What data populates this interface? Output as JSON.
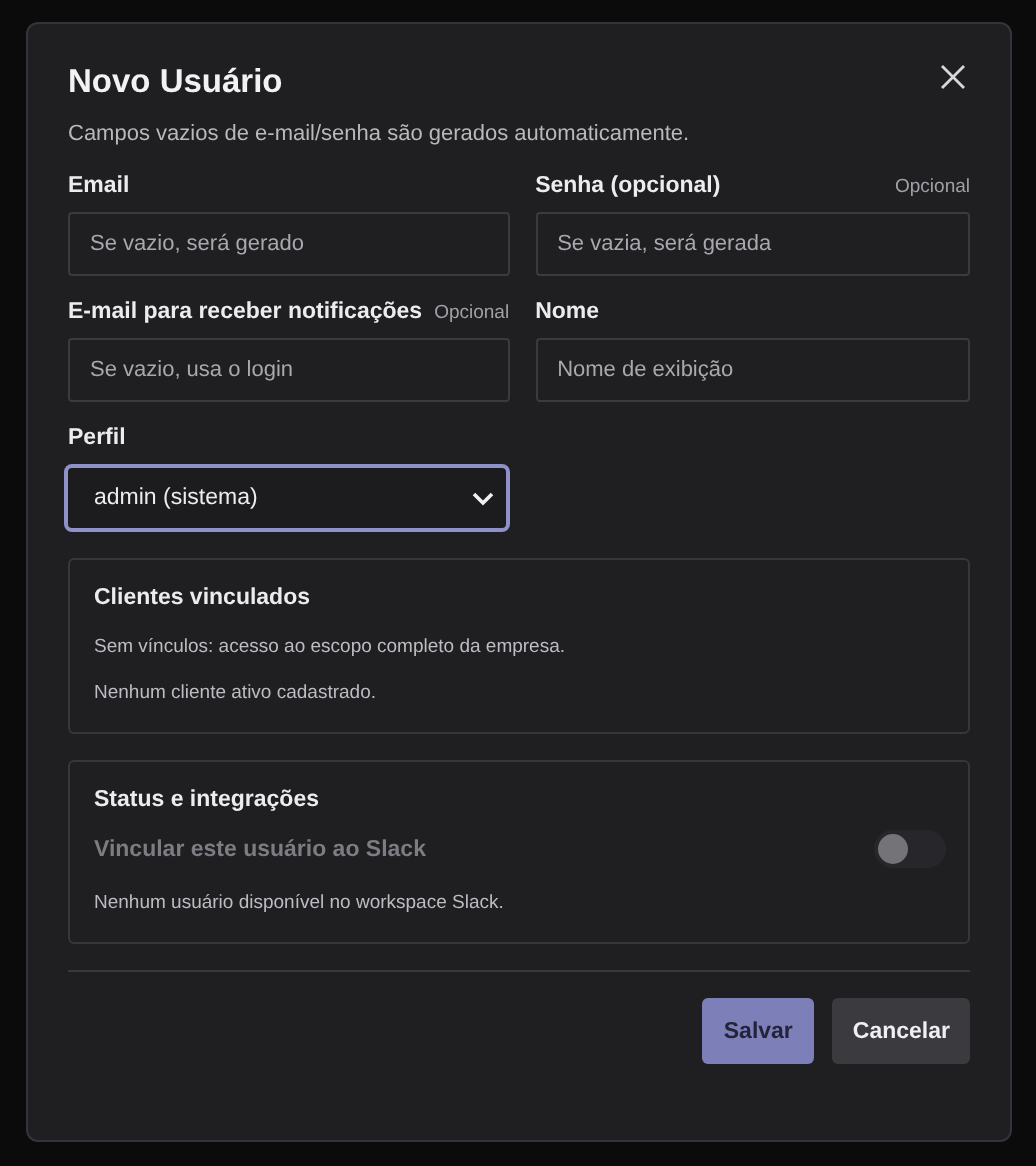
{
  "dialog": {
    "title": "Novo Usuário",
    "subtitle": "Campos vazios de e-mail/senha são gerados automaticamente."
  },
  "fields": [
    {
      "label": "Email",
      "placeholder": "Se vazio, será gerado"
    },
    {
      "label": "Senha (opcional)",
      "hint": "Opcional",
      "placeholder": "Se vazia, será gerada"
    },
    {
      "label": "E-mail para receber notificações",
      "hint": "Opcional",
      "placeholder": "Se vazio, usa o login"
    },
    {
      "label": "Nome",
      "placeholder": "Nome de exibição"
    }
  ],
  "profile": {
    "label": "Perfil",
    "value": "admin (sistema)",
    "focused": true
  },
  "sections": [
    {
      "title": "Clientes vinculados",
      "lines": [
        "Sem vínculos: acesso ao escopo completo da empresa.",
        "Nenhum cliente ativo cadastrado."
      ]
    },
    {
      "title": "Status e integrações",
      "toggle": {
        "label": "Vincular este usuário ao Slack",
        "on": false,
        "disabled": true
      },
      "lines": [
        "Nenhum usuário disponível no workspace Slack."
      ]
    }
  ],
  "buttons": [
    {
      "label": "Salvar",
      "kind": "primary"
    },
    {
      "label": "Cancelar",
      "kind": "secondary"
    }
  ]
}
